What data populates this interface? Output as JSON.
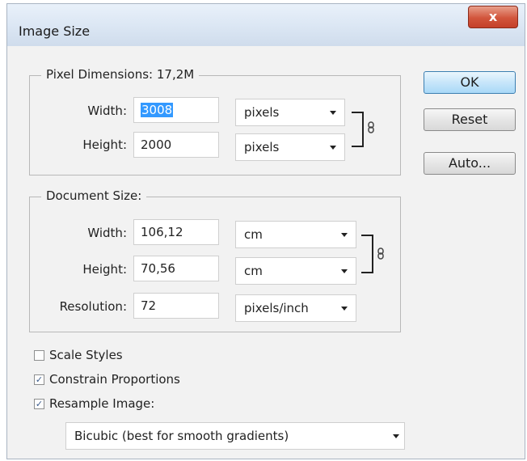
{
  "window": {
    "title": "Image Size",
    "close_glyph": "x"
  },
  "pixel_dimensions": {
    "label": "Pixel Dimensions:",
    "size": "17,2M",
    "width_label": "Width:",
    "width_value": "3008",
    "width_unit": "pixels",
    "height_label": "Height:",
    "height_value": "2000",
    "height_unit": "pixels"
  },
  "document_size": {
    "label": "Document Size:",
    "width_label": "Width:",
    "width_value": "106,12",
    "width_unit": "cm",
    "height_label": "Height:",
    "height_value": "70,56",
    "height_unit": "cm",
    "resolution_label": "Resolution:",
    "resolution_value": "72",
    "resolution_unit": "pixels/inch"
  },
  "buttons": {
    "ok": "OK",
    "reset": "Reset",
    "auto": "Auto..."
  },
  "options": {
    "scale_styles": {
      "label": "Scale Styles",
      "checked": false
    },
    "constrain_proportions": {
      "label": "Constrain Proportions",
      "checked": true
    },
    "resample_image": {
      "label": "Resample Image:",
      "checked": true
    },
    "resample_method": "Bicubic (best for smooth gradients)"
  },
  "icons": {
    "checkmark_glyph": "✓",
    "chain": "link-icon"
  }
}
